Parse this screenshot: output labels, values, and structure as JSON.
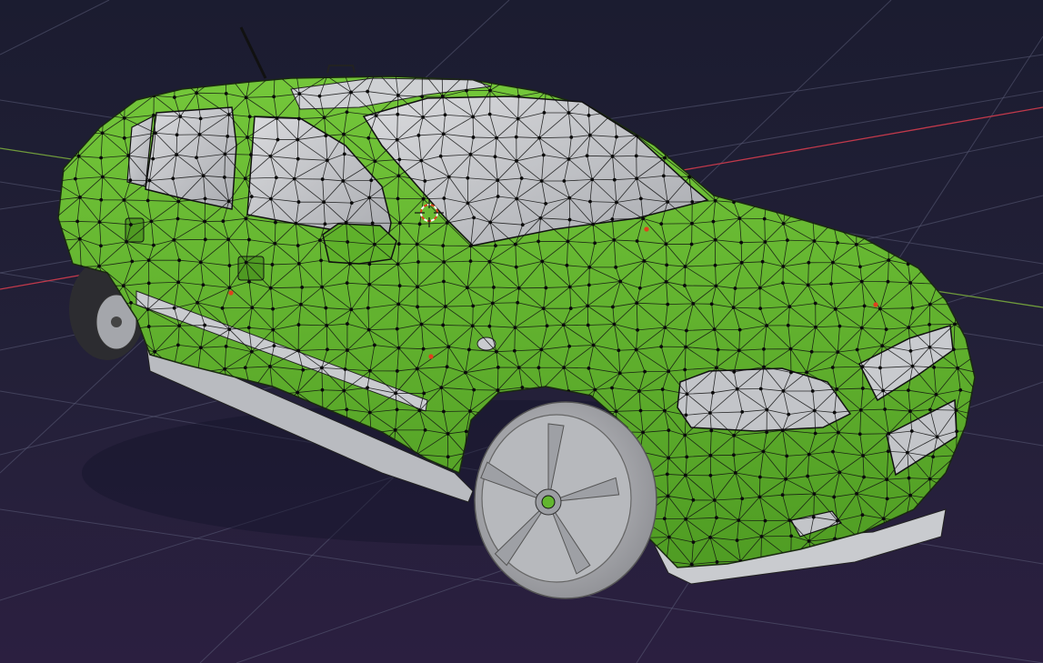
{
  "viewport": {
    "mode": "edit-mode",
    "shading": "solid",
    "background_top": "#1b1c30",
    "background_bottom": "#2b1f40",
    "grid_color": "#5b5d78",
    "x_axis_color": "#c0394b",
    "y_axis_color": "#6f9a3c"
  },
  "model": {
    "kind": "hatchback-car-mesh",
    "selected_face_color": "#62b62e",
    "unselected_face_color": "#c9cbcf",
    "edge_color": "#111111",
    "vertex_color": "#0a0a0a",
    "origin_color": "#e0401e"
  },
  "gizmos": {
    "cursor_3d": "3d-cursor-icon"
  }
}
